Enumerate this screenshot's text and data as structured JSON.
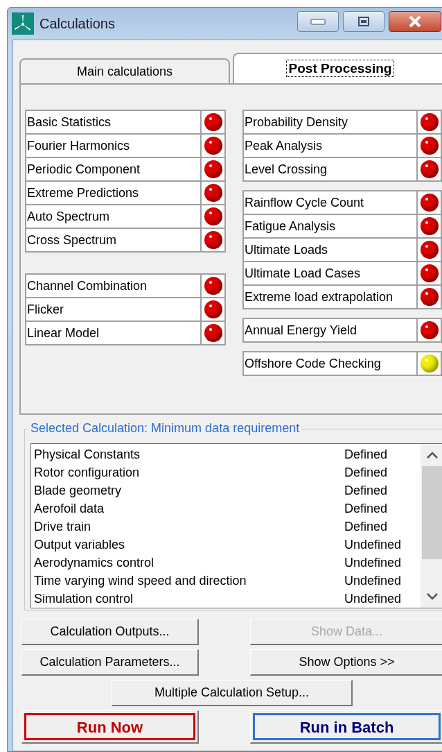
{
  "window": {
    "title": "Calculations"
  },
  "tabs": [
    {
      "label": "Main calculations",
      "selected": false
    },
    {
      "label": "Post Processing",
      "selected": true
    }
  ],
  "left_groups": [
    {
      "items": [
        {
          "label": "Basic Statistics",
          "color": "#e00000"
        },
        {
          "label": "Fourier Harmonics",
          "color": "#e00000"
        },
        {
          "label": "Periodic Component",
          "color": "#e00000"
        },
        {
          "label": "Extreme Predictions",
          "color": "#e00000"
        },
        {
          "label": "Auto Spectrum",
          "color": "#e00000"
        },
        {
          "label": "Cross Spectrum",
          "color": "#e00000"
        }
      ]
    },
    {
      "items": [
        {
          "label": "Channel Combination",
          "color": "#e00000"
        },
        {
          "label": "Flicker",
          "color": "#e00000"
        },
        {
          "label": "Linear Model",
          "color": "#e00000"
        }
      ]
    }
  ],
  "right_groups": [
    {
      "items": [
        {
          "label": "Probability Density",
          "color": "#e00000"
        },
        {
          "label": "Peak Analysis",
          "color": "#e00000"
        },
        {
          "label": "Level Crossing",
          "color": "#e00000"
        }
      ]
    },
    {
      "items": [
        {
          "label": "Rainflow Cycle Count",
          "color": "#e00000"
        },
        {
          "label": "Fatigue Analysis",
          "color": "#e00000"
        },
        {
          "label": "Ultimate Loads",
          "color": "#e00000"
        },
        {
          "label": "Ultimate Load Cases",
          "color": "#e00000"
        },
        {
          "label": "Extreme load extrapolation",
          "color": "#e00000"
        }
      ]
    },
    {
      "items": [
        {
          "label": "Annual Energy Yield",
          "color": "#e00000"
        }
      ]
    },
    {
      "items": [
        {
          "label": "Offshore Code Checking",
          "color": "#f0f000"
        }
      ]
    }
  ],
  "requirements": {
    "title": "Selected Calculation: Minimum data requirement",
    "rows": [
      {
        "item": "Physical Constants",
        "status": "Defined"
      },
      {
        "item": "Rotor configuration",
        "status": "Defined"
      },
      {
        "item": "Blade geometry",
        "status": "Defined"
      },
      {
        "item": "Aerofoil data",
        "status": "Defined"
      },
      {
        "item": "Drive train",
        "status": "Defined"
      },
      {
        "item": "Output variables",
        "status": "Undefined"
      },
      {
        "item": "Aerodynamics control",
        "status": "Undefined"
      },
      {
        "item": "Time varying wind speed and direction",
        "status": "Undefined"
      },
      {
        "item": "Simulation control",
        "status": "Undefined"
      }
    ]
  },
  "buttons": [
    {
      "label": "Calculation Outputs...",
      "kind": "plain",
      "disabled": false
    },
    {
      "label": "Show Data...",
      "kind": "plain",
      "disabled": true
    },
    {
      "label": "Calculation Parameters...",
      "kind": "plain",
      "disabled": false
    },
    {
      "label": "Show Options >>",
      "kind": "plain",
      "disabled": false
    },
    {
      "label": "Multiple Calculation Setup...",
      "kind": "wide",
      "disabled": false
    },
    {
      "label": "Run Now",
      "kind": "run",
      "color": "#d00000",
      "disabled": false
    },
    {
      "label": "Run in Batch",
      "kind": "run",
      "color": "#2f6fd6",
      "disabled": false
    }
  ]
}
